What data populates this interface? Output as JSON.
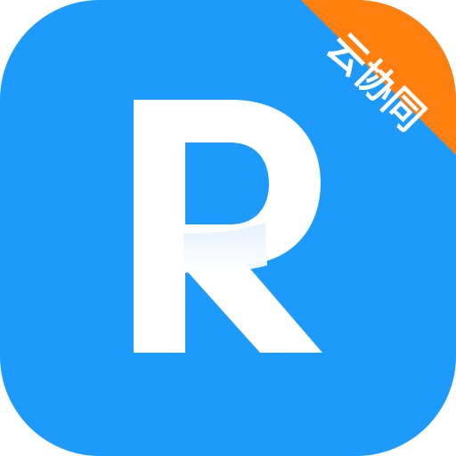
{
  "app_icon": {
    "letter": "R",
    "ribbon_text": "云协同",
    "colors": {
      "background": "#1C9BFD",
      "letter": "#FFFFFF",
      "ribbon": "#FF7F0E",
      "ribbon_text": "#FFFFFF"
    }
  }
}
